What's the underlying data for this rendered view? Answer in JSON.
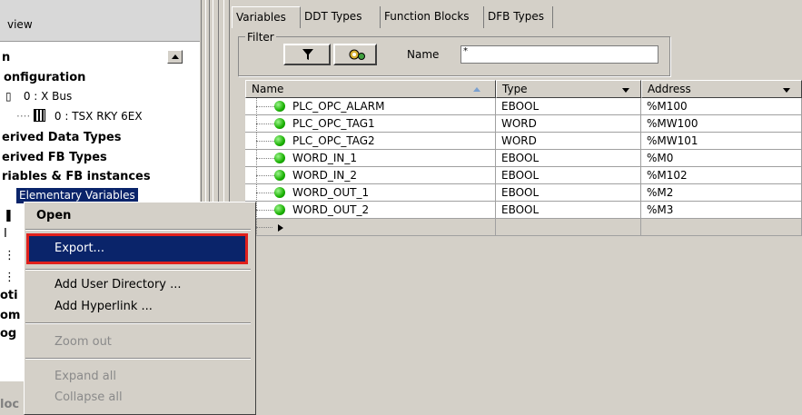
{
  "left_panel": {
    "header": "view",
    "tree": [
      {
        "text": "n",
        "style": "bold"
      },
      {
        "text": "onfiguration",
        "style": "bold"
      },
      {
        "text": "0 : X Bus",
        "style": "small"
      },
      {
        "text": "0 : TSX RKY 6EX",
        "style": "small"
      },
      {
        "text": "erived Data Types",
        "style": "bold"
      },
      {
        "text": "erived FB Types",
        "style": "bold"
      },
      {
        "text": "riables & FB instances",
        "style": "bold"
      },
      {
        "text": "Elementary Variables",
        "style": "selected"
      }
    ],
    "partial_lines": [
      "oti",
      "om",
      "og",
      "loc"
    ]
  },
  "tabs": [
    "Variables",
    "DDT Types",
    "Function Blocks",
    "DFB Types"
  ],
  "filter": {
    "label": "Filter",
    "name_label": "Name",
    "name_value": "*"
  },
  "grid": {
    "columns": [
      "Name",
      "Type",
      "Address"
    ],
    "rows": [
      {
        "name": "PLC_OPC_ALARM",
        "type": "EBOOL",
        "address": "%M100"
      },
      {
        "name": "PLC_OPC_TAG1",
        "type": "WORD",
        "address": "%MW100"
      },
      {
        "name": "PLC_OPC_TAG2",
        "type": "WORD",
        "address": "%MW101"
      },
      {
        "name": "WORD_IN_1",
        "type": "EBOOL",
        "address": "%M0"
      },
      {
        "name": "WORD_IN_2",
        "type": "EBOOL",
        "address": "%M102"
      },
      {
        "name": "WORD_OUT_1",
        "type": "EBOOL",
        "address": "%M2"
      },
      {
        "name": "WORD_OUT_2",
        "type": "EBOOL",
        "address": "%M3"
      }
    ]
  },
  "context_menu": {
    "open": "Open",
    "export": "Export...",
    "add_user_directory": "Add User Directory ...",
    "add_hyperlink": "Add Hyperlink ...",
    "zoom_out": "Zoom out",
    "expand_all": "Expand all",
    "collapse_all": "Collapse all"
  },
  "colors": {
    "selection": "#0a246a",
    "highlight_border": "#e0201c",
    "status_dot": "#18b000",
    "face": "#d4d0c8"
  }
}
